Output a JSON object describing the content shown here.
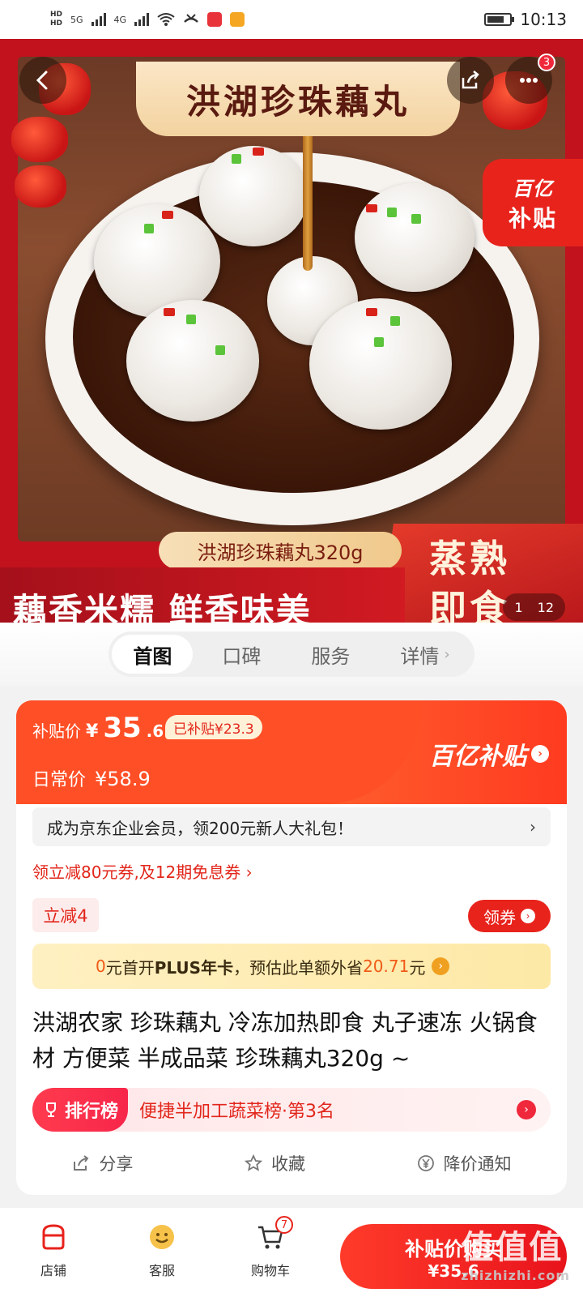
{
  "status_bar": {
    "hd1": "HD",
    "hd2": "HD",
    "net1": "5G",
    "net2": "4G",
    "time": "10:13"
  },
  "hero": {
    "banner_title": "洪湖珍珠藕丸",
    "share_icon": "share-icon",
    "more_badge": "3",
    "subsidy_line1": "百亿",
    "subsidy_line2": "补贴",
    "weight_tag": "洪湖珍珠藕丸320g",
    "slogan": "藕香米糯 鲜香味美",
    "steam_line1": "蒸熟",
    "steam_line2": "即食",
    "pager_current": "1",
    "pager_total": "12"
  },
  "tabs": [
    {
      "label": "首图",
      "active": true
    },
    {
      "label": "口碑"
    },
    {
      "label": "服务"
    },
    {
      "label": "详情"
    }
  ],
  "price": {
    "subsidy_label": "补贴价",
    "currency": "¥",
    "price_int": "35",
    "price_dec": ".6",
    "subsidized_tag": "已补贴¥23.3",
    "daily_label": "日常价",
    "daily_price": "¥58.9",
    "brand": "百亿补贴"
  },
  "member_banner": {
    "text": "成为京东企业会员，领200元新人大礼包！",
    "arrow": "›"
  },
  "coupon_line": "领立减80元券,及12期免息券 ›",
  "discount_tag": "立减4",
  "get_coupon_label": "领券",
  "plus_bar": {
    "prefix": "0",
    "middle": "元首开",
    "plus": "PLUS年卡",
    "suffix": "，预估此单额外省",
    "amount": "20.71",
    "unit": "元"
  },
  "product_title": "洪湖农家 珍珠藕丸 冷冻加热即食 丸子速冻 火锅食材 方便菜 半成品菜 珍珠藕丸320g ~",
  "ranking": {
    "tag": "排行榜",
    "text": "便捷半加工蔬菜榜·第3名"
  },
  "actions": {
    "share": "分享",
    "favorite": "收藏",
    "price_alert": "降价通知"
  },
  "bottom_bar": {
    "store": "店铺",
    "service": "客服",
    "cart": "购物车",
    "cart_count": "7",
    "buy_line1": "补贴价购买",
    "buy_line2": "¥35.6"
  },
  "watermark": {
    "text": "值值值",
    "url": "zhizhizhi.com"
  },
  "colors": {
    "brand_red": "#e8231c",
    "price_orange": "#ff4a24",
    "accent_text": "#e2261b"
  }
}
